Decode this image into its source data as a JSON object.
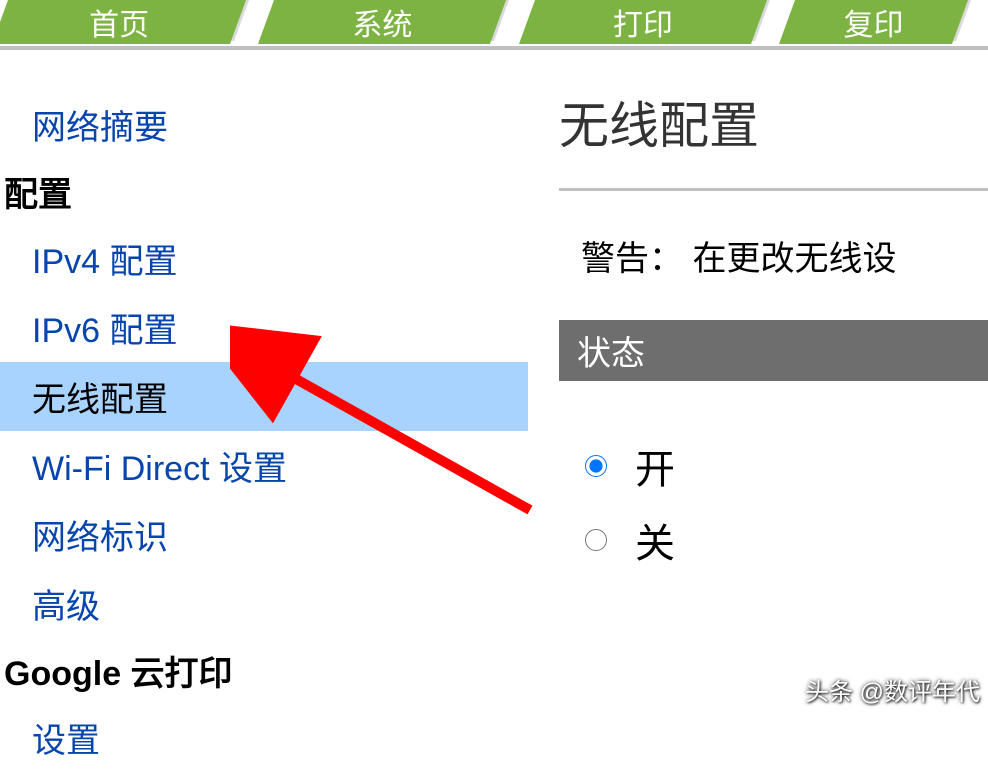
{
  "tabs": {
    "home": "首页",
    "system": "系统",
    "print": "打印",
    "copy": "复印"
  },
  "sidebar": {
    "summary": "网络摘要",
    "config_heading": "配置",
    "ipv4": "IPv4 配置",
    "ipv6": "IPv6 配置",
    "wireless": "无线配置",
    "wifi_direct": "Wi-Fi Direct 设置",
    "network_id": "网络标识",
    "advanced": "高级",
    "google_heading": "Google 云打印",
    "settings": "设置"
  },
  "main": {
    "title": "无线配置",
    "warning": "警告： 在更改无线设",
    "status_header": "状态",
    "radio_on": "开",
    "radio_off": "关"
  },
  "watermark": "头条 @数评年代"
}
